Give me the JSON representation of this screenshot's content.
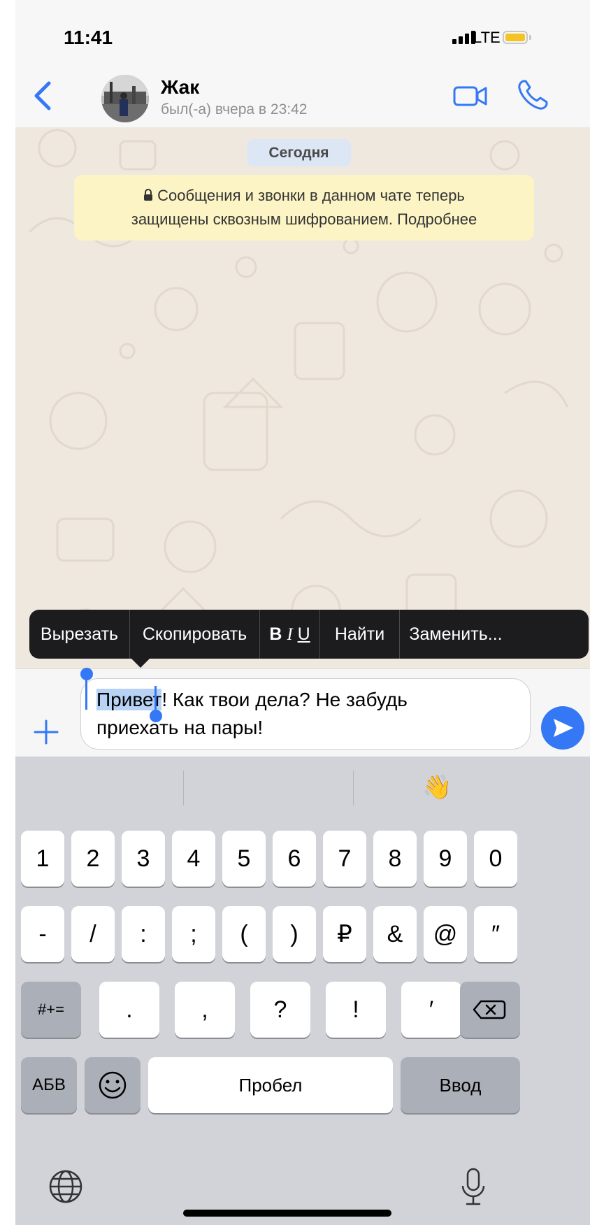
{
  "status_bar": {
    "time": "11:41",
    "network": "LTE"
  },
  "header": {
    "contact_name": "Жак",
    "contact_status": "был(-а) вчера в 23:42"
  },
  "chat": {
    "date_label": "Сегодня",
    "encryption_line1": "Сообщения и звонки в данном чате теперь",
    "encryption_line2": "защищены сквозным шифрованием. Подробнее"
  },
  "context_menu": {
    "cut": "Вырезать",
    "copy": "Скопировать",
    "format_bold": "B",
    "format_italic": "I",
    "format_underline": "U",
    "find": "Найти",
    "replace": "Заменить..."
  },
  "input": {
    "selected": "Привет",
    "rest_line1": "! Как твои дела? Не забудь",
    "line2": "приехать на пары!"
  },
  "keyboard": {
    "row1": [
      "1",
      "2",
      "3",
      "4",
      "5",
      "6",
      "7",
      "8",
      "9",
      "0"
    ],
    "row2": [
      "-",
      "/",
      ":",
      ";",
      "(",
      ")",
      "₽",
      "&",
      "@",
      "″"
    ],
    "row3": [
      ".",
      ",",
      "?",
      "!",
      "′"
    ],
    "symbols_key": "#+=",
    "letters_key": "АБВ",
    "space_key": "Пробел",
    "return_key": "Ввод",
    "suggestion_emoji": "👋"
  },
  "colors": {
    "accent": "#3478f6",
    "chat_bg": "#efe8df",
    "notice_bg": "#fcf4c4",
    "date_pill_bg": "#dce6f5"
  },
  "icons": [
    "back-chevron",
    "video-camera",
    "phone",
    "lock",
    "plus",
    "send-arrow",
    "emoji-face",
    "globe",
    "microphone",
    "backspace"
  ]
}
